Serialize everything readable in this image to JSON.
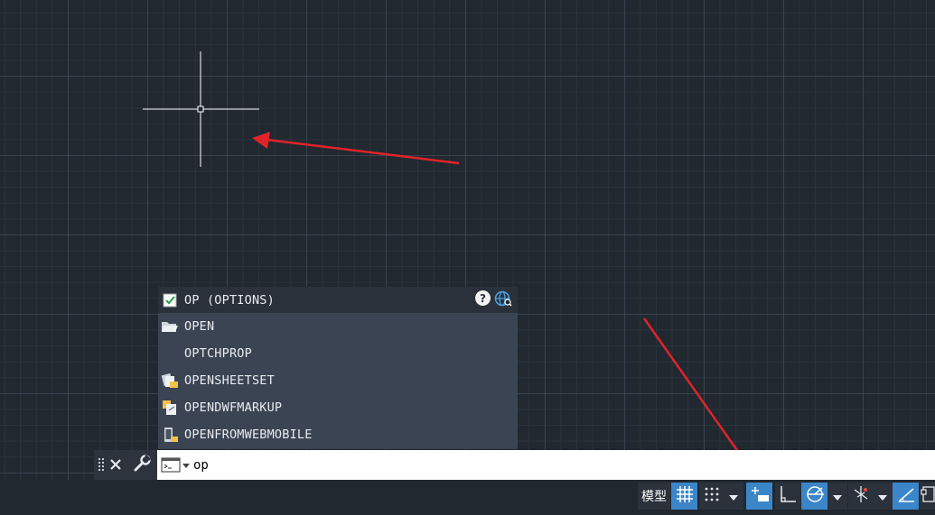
{
  "autocomplete": {
    "header": "OP (OPTIONS)",
    "items": [
      {
        "label": "OPEN",
        "icon": "folder-open-icon"
      },
      {
        "label": "OPTCHPROP",
        "icon": ""
      },
      {
        "label": "OPENSHEETSET",
        "icon": "sheetset-icon"
      },
      {
        "label": "OPENDWFMARKUP",
        "icon": "dwf-markup-icon"
      },
      {
        "label": "OPENFROMWEBMOBILE",
        "icon": "web-mobile-icon"
      }
    ]
  },
  "command_line": {
    "value": "op"
  },
  "status_bar": {
    "model_label": "模型"
  },
  "colors": {
    "canvas_bg": "#212830",
    "popup_bg": "#3b4453",
    "active_toggle": "#3a86c9",
    "annotation_arrow": "#e0242a"
  }
}
